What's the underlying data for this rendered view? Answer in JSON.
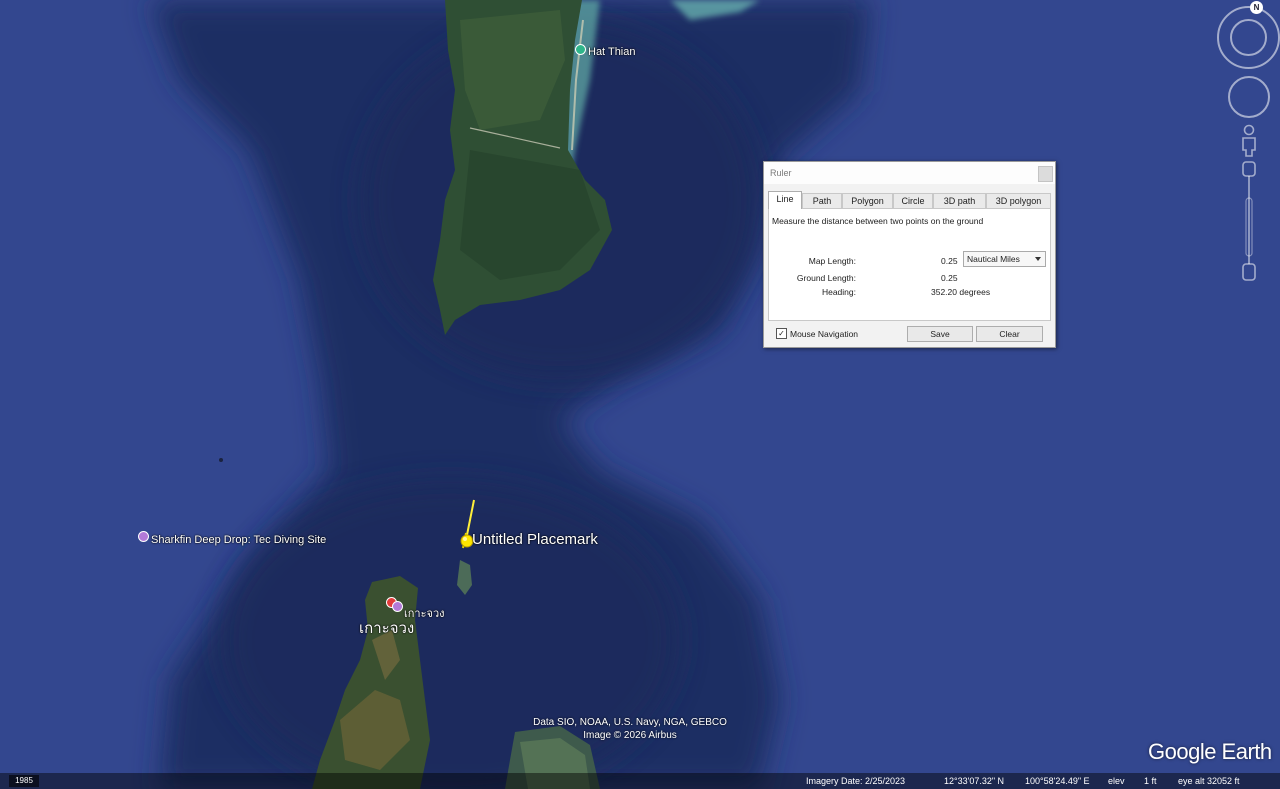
{
  "map": {
    "places": {
      "hat_thian": "Hat Thian",
      "sharkfin": "Sharkfin Deep Drop: Tec Diving Site",
      "island_small": "เกาะจวง",
      "island_large": "เกาะจวง"
    },
    "placemark_label": "Untitled Placemark",
    "attribution_line1": "Data SIO, NOAA, U.S. Navy, NGA, GEBCO",
    "attribution_line2": "Image © 2026 Airbus",
    "brand": "Google Earth"
  },
  "navigation": {
    "north_label": "N"
  },
  "ruler": {
    "title": "Ruler",
    "tabs": [
      {
        "label": "Line",
        "active": true
      },
      {
        "label": "Path"
      },
      {
        "label": "Polygon"
      },
      {
        "label": "Circle"
      },
      {
        "label": "3D path"
      },
      {
        "label": "3D polygon"
      }
    ],
    "description": "Measure the distance between two points on the ground",
    "map_length_label": "Map Length:",
    "map_length_value": "0.25",
    "unit": "Nautical Miles",
    "ground_length_label": "Ground Length:",
    "ground_length_value": "0.25",
    "heading_label": "Heading:",
    "heading_value": "352.20 degrees",
    "mouse_nav_label": "Mouse Navigation",
    "mouse_nav_checked": true,
    "save_label": "Save",
    "clear_label": "Clear"
  },
  "status": {
    "year": "1985",
    "imagery_date": "Imagery Date: 2/25/2023",
    "lat": "12°33'07.32\" N",
    "lon": "100°58'24.49\" E",
    "elev_label": "elev",
    "elev_value": "1 ft",
    "eye_alt": "eye alt  32052 ft"
  }
}
